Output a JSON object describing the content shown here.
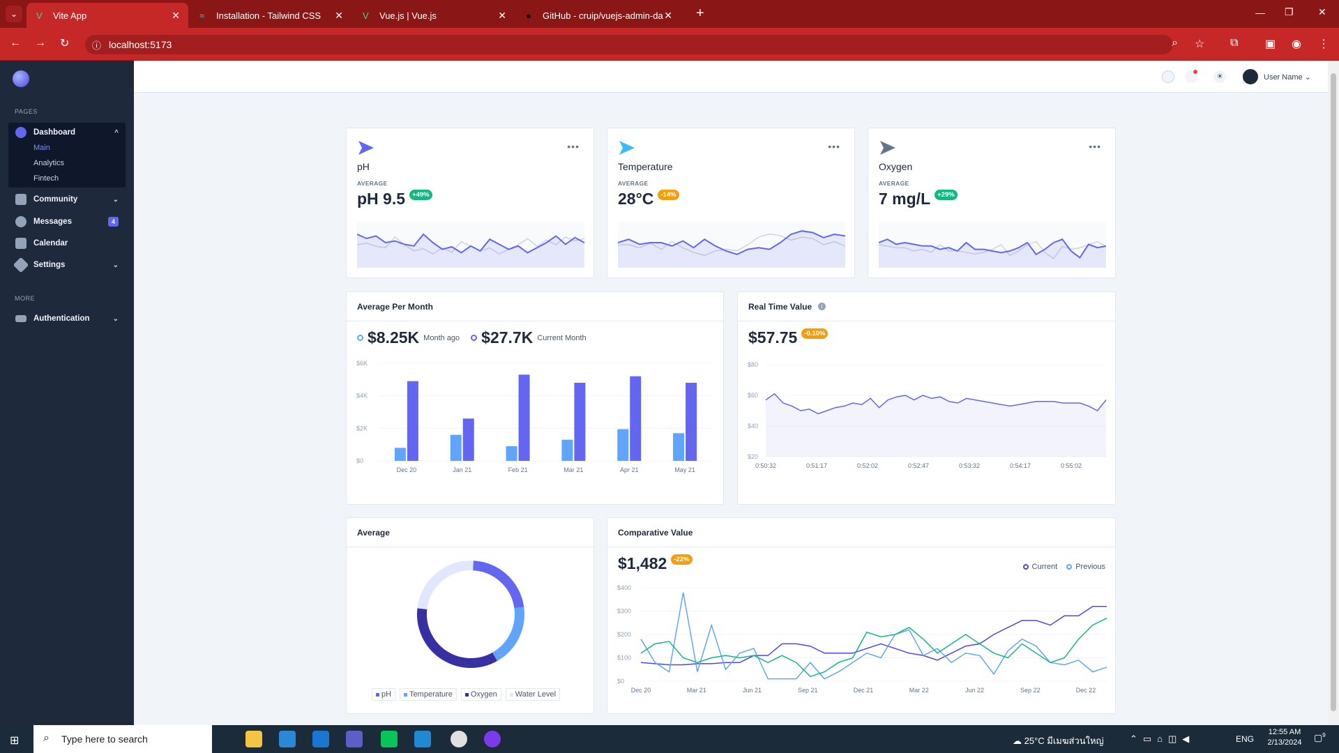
{
  "browser": {
    "tabs": [
      {
        "label": "Vite App",
        "active": true
      },
      {
        "label": "Installation - Tailwind CSS"
      },
      {
        "label": "Vue.js | Vue.js"
      },
      {
        "label": "GitHub - cruip/vuejs-admin-da"
      }
    ],
    "url": "localhost:5173"
  },
  "sidebar": {
    "pages_label": "PAGES",
    "more_label": "MORE",
    "dashboard": "Dashboard",
    "sub": [
      "Main",
      "Analytics",
      "Fintech"
    ],
    "community": "Community",
    "messages": "Messages",
    "messages_count": "4",
    "calendar": "Calendar",
    "settings": "Settings",
    "authentication": "Authentication"
  },
  "header": {
    "user": "User Name"
  },
  "stats": [
    {
      "title": "pH",
      "label": "AVERAGE",
      "value": "pH 9.5",
      "badge": "+49%",
      "icon_color": "#6366f1"
    },
    {
      "title": "Temperature",
      "label": "AVERAGE",
      "value": "28°C",
      "badge": "-14%",
      "icon_color": "#38bdf8"
    },
    {
      "title": "Oxygen",
      "label": "AVERAGE",
      "value": "7 mg/L",
      "badge": "+29%",
      "icon_color": "#64748b"
    }
  ],
  "avg_month": {
    "title": "Average Per Month",
    "v1": "$8.25K",
    "l1": "Month ago",
    "v2": "$27.7K",
    "l2": "Current Month"
  },
  "realtime": {
    "title": "Real Time Value",
    "value": "$57.75",
    "badge": "-0.10%"
  },
  "average": {
    "title": "Average",
    "legend": [
      "pH",
      "Temperature",
      "Oxygen",
      "Water Level"
    ]
  },
  "comparative": {
    "title": "Comparative Value",
    "value": "$1,482",
    "badge": "-22%",
    "legend": [
      "Current",
      "Previous"
    ]
  },
  "taskbar": {
    "search": "Type here to search",
    "weather": "25°C มีเมฆส่วนใหญ่",
    "lang": "ENG",
    "time": "12:55 AM",
    "date": "2/13/2024",
    "notif": "9"
  },
  "chart_data": [
    {
      "type": "bar",
      "title": "Average Per Month",
      "categories": [
        "Dec 20",
        "Jan 21",
        "Feb 21",
        "Mar 21",
        "Apr 21",
        "May 21"
      ],
      "series": [
        {
          "name": "Month ago",
          "values": [
            800,
            1600,
            900,
            1300,
            1950,
            1700
          ]
        },
        {
          "name": "Current Month",
          "values": [
            4900,
            2600,
            5300,
            4800,
            5200,
            4800
          ]
        }
      ],
      "yticks": [
        "$0",
        "$2K",
        "$4K",
        "$6K"
      ],
      "ylim": [
        0,
        6000
      ],
      "colors": [
        "#60a5fa",
        "#6366f1"
      ]
    },
    {
      "type": "line",
      "title": "Real Time Value",
      "x": [
        "0:50:32",
        "0:51:17",
        "0:52:02",
        "0:52:47",
        "0:53:32",
        "0:54:17",
        "0:55:02"
      ],
      "yticks": [
        "$20",
        "$40",
        "$60",
        "$80"
      ],
      "ylim": [
        20,
        80
      ],
      "values": [
        57,
        61,
        55,
        53,
        50,
        51,
        48,
        50,
        52,
        53,
        55,
        54,
        58,
        52,
        57,
        59,
        60,
        57,
        60,
        58,
        59,
        56,
        55,
        58,
        57,
        56,
        55,
        54,
        53,
        54,
        55,
        56,
        56,
        56,
        55,
        55,
        55,
        53,
        50,
        57
      ]
    },
    {
      "type": "line",
      "title": "Comparative Value",
      "x": [
        "Dec 20",
        "Mar 21",
        "Jun 21",
        "Sep 21",
        "Dec 21",
        "Mar 22",
        "Jun 22",
        "Sep 22",
        "Dec 22"
      ],
      "yticks": [
        "$0",
        "$100",
        "$200",
        "$300",
        "$400"
      ],
      "ylim": [
        0,
        400
      ],
      "series": [
        {
          "name": "Current",
          "values": [
            80,
            75,
            70,
            70,
            75,
            75,
            80,
            80,
            110,
            110,
            160,
            160,
            150,
            120,
            120,
            120,
            140,
            160,
            140,
            120,
            110,
            90,
            120,
            150,
            160,
            200,
            230,
            260,
            260,
            240,
            280,
            280,
            320,
            320
          ]
        },
        {
          "name": "Previous",
          "values": [
            180,
            80,
            40,
            380,
            40,
            240,
            50,
            120,
            140,
            10,
            10,
            10,
            80,
            10,
            40,
            80,
            120,
            100,
            200,
            220,
            110,
            140,
            80,
            120,
            110,
            30,
            130,
            180,
            150,
            80,
            70,
            90,
            40,
            60
          ]
        },
        {
          "name": "",
          "values": [
            120,
            160,
            170,
            100,
            80,
            100,
            110,
            100,
            110,
            80,
            110,
            80,
            20,
            40,
            80,
            100,
            210,
            190,
            200,
            230,
            180,
            120,
            160,
            200,
            160,
            120,
            100,
            160,
            120,
            80,
            100,
            180,
            240,
            270
          ]
        }
      ]
    },
    {
      "type": "pie",
      "title": "Average",
      "categories": [
        "pH",
        "Temperature",
        "Oxygen",
        "Water Level"
      ],
      "values": [
        22,
        19,
        35,
        24
      ],
      "colors": [
        "#6366f1",
        "#60a5fa",
        "#3730a3",
        "#e0e7ff"
      ]
    },
    {
      "type": "line",
      "title": "pH",
      "values": [
        40,
        35,
        38,
        30,
        32,
        28,
        26,
        40,
        30,
        22,
        25,
        18,
        26,
        20,
        34,
        28,
        22,
        26,
        18,
        24,
        30,
        38,
        28,
        36,
        30
      ]
    },
    {
      "type": "line",
      "title": "Temperature",
      "values": [
        30,
        34,
        28,
        30,
        30,
        26,
        32,
        24,
        34,
        26,
        20,
        16,
        22,
        24,
        22,
        30,
        40,
        44,
        42,
        36,
        40,
        38
      ]
    },
    {
      "type": "line",
      "title": "Oxygen",
      "values": [
        30,
        34,
        28,
        30,
        28,
        26,
        26,
        22,
        24,
        20,
        30,
        22,
        22,
        20,
        18,
        20,
        24,
        30,
        16,
        22,
        30,
        34,
        20,
        12,
        28,
        24,
        26
      ]
    }
  ]
}
